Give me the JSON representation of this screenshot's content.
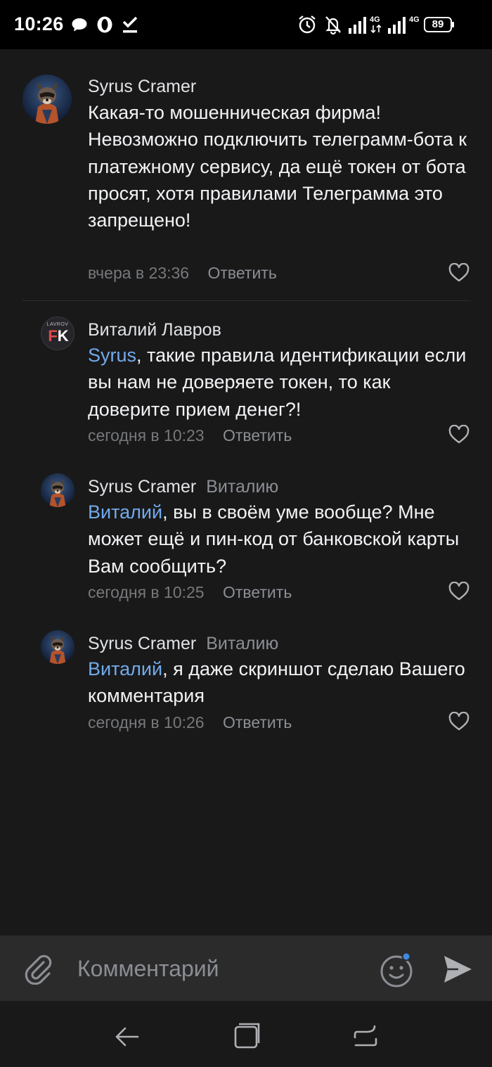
{
  "status_bar": {
    "time": "10:26",
    "battery": "89",
    "network": "4G"
  },
  "comments": [
    {
      "author": "Syrus Cramer",
      "reply_to": "",
      "mention": "",
      "text": "Какая-то мошенническая фирма! Невозможно подключить телеграмм-бота к платежному сервису, да ещё токен от бота просят, хотя правилами Телеграмма это запрещено!",
      "time": "вчера в 23:36",
      "reply_label": "Ответить"
    },
    {
      "author": "Виталий Лавров",
      "reply_to": "",
      "mention": "Syrus",
      "text": ", такие правила идентификации если вы нам не доверяете токен, то как доверите прием денег?!",
      "time": "сегодня в 10:23",
      "reply_label": "Ответить",
      "avatar_text": {
        "top": "LAVROV",
        "f": "F",
        "k": "K"
      }
    },
    {
      "author": "Syrus Cramer",
      "reply_to": "Виталию",
      "mention": "Виталий",
      "text": ", вы в своём уме вообще? Мне может ещё  и пин-код от банковской карты Вам сообщить?",
      "time": "сегодня в 10:25",
      "reply_label": "Ответить"
    },
    {
      "author": "Syrus Cramer",
      "reply_to": "Виталию",
      "mention": "Виталий",
      "text": ", я даже скриншот сделаю Вашего комментария",
      "time": "сегодня в 10:26",
      "reply_label": "Ответить"
    }
  ],
  "input": {
    "placeholder": "Комментарий"
  },
  "colors": {
    "background": "#19191a",
    "mention": "#71aaeb",
    "input_bar": "#2b2b2c",
    "emoji_dot": "#3f8ae0"
  }
}
